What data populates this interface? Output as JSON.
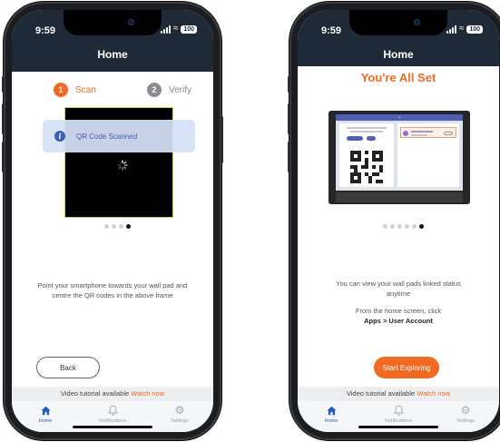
{
  "scan_screen": {
    "status_time": "9:59",
    "battery": "100",
    "nav_title": "Home",
    "step1_num": "1",
    "step1_label": "Scan",
    "step2_num": "2",
    "step2_label": "Verify",
    "toast_text": "QR Code Scanned",
    "instruction": "Point your smartphone towards your wall pad and centre the QR codes in the above frame",
    "back_label": "Back",
    "tutorial_text": "Video tutorial available",
    "tutorial_link": "Watch now",
    "tabs": [
      {
        "label": "Home",
        "icon": "home-icon"
      },
      {
        "label": "Notifications",
        "icon": "bell-icon"
      },
      {
        "label": "Settings",
        "icon": "gear-icon"
      }
    ],
    "dots_total": 4,
    "dots_active": 4
  },
  "success_screen": {
    "status_time": "9:59",
    "battery": "100",
    "nav_title": "Home",
    "title": "You're All Set",
    "message": "You can view your wall pads linked status anytime",
    "hint_line": "From the home screen, click",
    "hint_path": "Apps > User Account",
    "primary_label": "Start Exploring",
    "tutorial_text": "Video tutorial available",
    "tutorial_link": "Watch now",
    "tabs": [
      {
        "label": "Home",
        "icon": "home-icon"
      },
      {
        "label": "Notifications",
        "icon": "bell-icon"
      },
      {
        "label": "Settings",
        "icon": "gear-icon"
      }
    ],
    "dots_total": 6,
    "dots_active": 6
  },
  "colors": {
    "accent": "#f26a21",
    "nav_bg": "#1f2a38",
    "scanner_border": "#b8df3a",
    "toast_bg": "#d6e1f6",
    "tab_active": "#1f5fbf"
  }
}
